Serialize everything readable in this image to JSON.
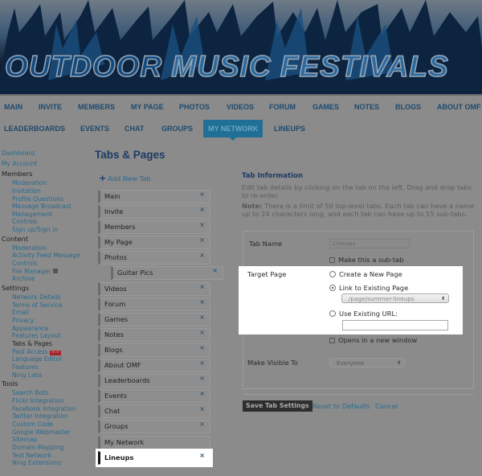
{
  "header": {
    "logo_text_1": "OUTDOOR",
    "logo_text_2": "MUSIC FESTIVALS"
  },
  "nav": {
    "row1": [
      "MAIN",
      "INVITE",
      "MEMBERS",
      "MY PAGE",
      "PHOTOS",
      "VIDEOS",
      "FORUM",
      "GAMES",
      "NOTES",
      "BLOGS",
      "ABOUT OMF"
    ],
    "row2": [
      "LEADERBOARDS",
      "EVENTS",
      "CHAT",
      "GROUPS",
      "MY NETWORK",
      "LINEUPS"
    ],
    "active": "MY NETWORK",
    "accent": "#1f6f96"
  },
  "sidebar": {
    "top": [
      "Dashboard",
      "My Account"
    ],
    "groups": [
      {
        "title": "Members",
        "items": [
          "Moderation",
          "Invitation",
          "Profile Questions",
          "Message Broadcast",
          "Management",
          "Controls",
          "Sign up/Sign in"
        ]
      },
      {
        "title": "Content",
        "items": [
          "Moderation",
          "Activity Feed Message",
          "Controls",
          "File Manager",
          "Archive"
        ]
      },
      {
        "title": "Settings",
        "items": [
          "Network Details",
          "Terms of Service",
          "Email",
          "Privacy",
          "Appearance",
          "Features Layout",
          "Tabs & Pages",
          "Paid Access",
          "Language Editor",
          "Features",
          "Ning Labs"
        ]
      },
      {
        "title": "Tools",
        "items": [
          "Search Bots",
          "Flickr Integration",
          "Facebook Integration",
          "Twitter Integration",
          "Custom Code",
          "Google Webmaster",
          "Sitemap",
          "Domain Mapping",
          "Test Network",
          "Ning Extensions"
        ]
      }
    ],
    "current": "Tabs & Pages",
    "new_badge": "NEW"
  },
  "main": {
    "title": "Tabs & Pages",
    "add_tab": "Add New Tab",
    "tabs": [
      {
        "label": "Main",
        "removable": true
      },
      {
        "label": "Invite",
        "removable": true
      },
      {
        "label": "Members",
        "removable": true
      },
      {
        "label": "My Page",
        "removable": true
      },
      {
        "label": "Photos",
        "removable": true
      },
      {
        "label": "Guitar Pics",
        "removable": true,
        "sub": true
      },
      {
        "label": "Videos",
        "removable": true
      },
      {
        "label": "Forum",
        "removable": true
      },
      {
        "label": "Games",
        "removable": true
      },
      {
        "label": "Notes",
        "removable": true
      },
      {
        "label": "Blogs",
        "removable": true
      },
      {
        "label": "About OMF",
        "removable": true
      },
      {
        "label": "Leaderboards",
        "removable": true
      },
      {
        "label": "Events",
        "removable": true
      },
      {
        "label": "Chat",
        "removable": true
      },
      {
        "label": "Groups",
        "removable": true
      },
      {
        "label": "My Network",
        "removable": false
      },
      {
        "label": "Lineups",
        "removable": true,
        "selected": true
      }
    ]
  },
  "info": {
    "title": "Tab Information",
    "desc": "Edit tab details by clicking on the tab on the left. Drag and drop tabs to re-order.",
    "note_label": "Note:",
    "note": " There is a limit of 50 top-level tabs. Each tab can have a name up to 24 characters long, and each tab can have up to 15 sub-tabs."
  },
  "form": {
    "tab_name_label": "Tab Name",
    "tab_name_value": "Lineups",
    "subtab_label": "Make this a sub-tab",
    "target_label": "Target Page",
    "opt_new": "Create a New Page",
    "opt_existing": "Link to Existing Page",
    "existing_value": "/page/summer-lineups",
    "opt_url": "Use Existing URL:",
    "url_value": "",
    "new_window_label": "Opens in a new window",
    "visible_label": "Make Visible To",
    "visible_value": "Everyone",
    "save": "Save Tab Settings",
    "reset": "Reset to Defaults",
    "cancel": "Cancel"
  }
}
